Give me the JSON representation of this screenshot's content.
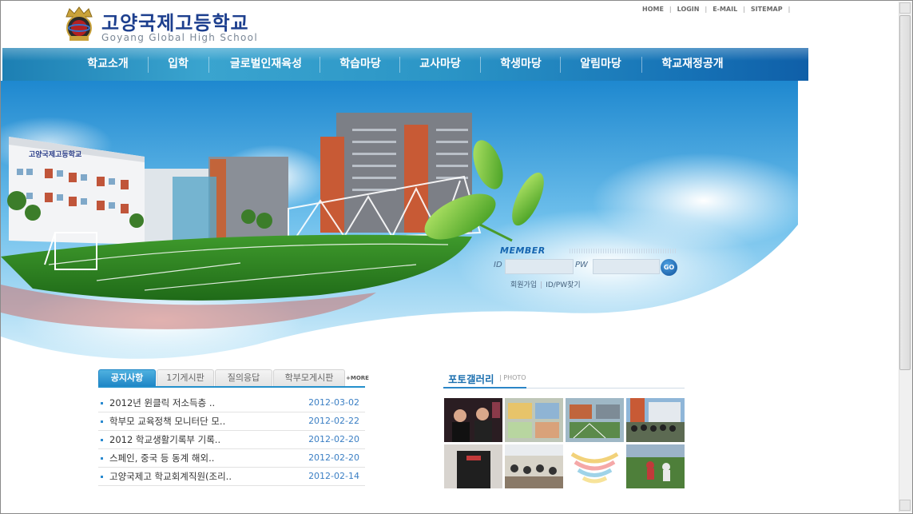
{
  "header": {
    "school_name": "고양국제고등학교",
    "school_name_en": "Goyang Global High School",
    "util_nav": [
      "HOME",
      "LOGIN",
      "E-MAIL",
      "SITEMAP"
    ]
  },
  "gnb": {
    "items": [
      "학교소개",
      "입학",
      "글로벌인재육성",
      "학습마당",
      "교사마당",
      "학생마당",
      "알림마당",
      "학교재정공개"
    ]
  },
  "hero": {
    "building_sign": "고양국제고등학교"
  },
  "member": {
    "label": "MEMBER",
    "id_label": "ID",
    "pw_label": "PW",
    "go_label": "GO",
    "join_link": "회원가입",
    "find_link": "ID/PW찾기"
  },
  "board": {
    "tabs": [
      "공지사항",
      "1기게시판",
      "질의응답",
      "학부모게시판"
    ],
    "active_tab": 0,
    "more_label": "+MORE",
    "items": [
      {
        "title": "2012년 윈클릭 저소득층 ..",
        "date": "2012-03-02"
      },
      {
        "title": "학부모 교육정책 모니터단 모..",
        "date": "2012-02-22"
      },
      {
        "title": "2012 학교생활기록부 기록..",
        "date": "2012-02-20"
      },
      {
        "title": "스페인, 중국 등 동계 해외..",
        "date": "2012-02-20"
      },
      {
        "title": "고양국제고 학교회계직원(조리..",
        "date": "2012-02-14"
      }
    ]
  },
  "gallery": {
    "title": "포토갤러리",
    "subtitle": "| PHOTO"
  },
  "colors": {
    "brand_blue": "#1d3f8e",
    "nav_blue": "#1f86c6",
    "date_blue": "#3b7fc4"
  }
}
